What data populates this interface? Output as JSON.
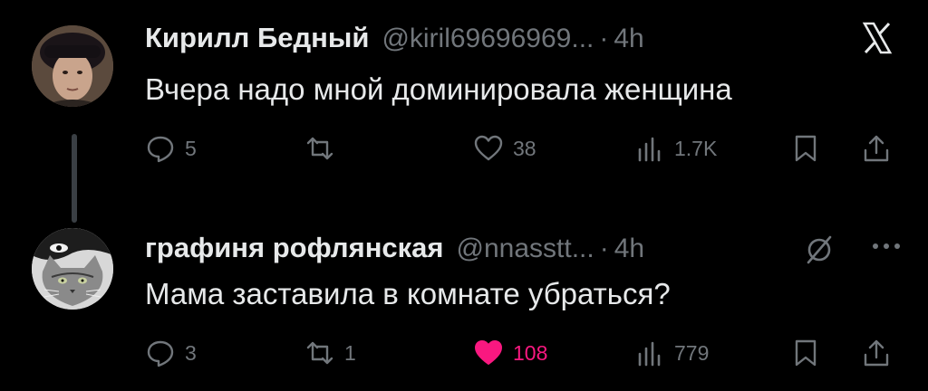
{
  "tweets": [
    {
      "name": "Кирилл Бедный",
      "handle": "@kiril69696969...",
      "separator": "·",
      "time": "4h",
      "text": "Вчера надо мной доминировала женщина",
      "actions": {
        "replies": "5",
        "retweets": "",
        "likes": "38",
        "views": "1.7K"
      },
      "liked": false
    },
    {
      "name": "графиня рофлянская",
      "handle": "@nnasstt...",
      "separator": "·",
      "time": "4h",
      "text": "Мама заставила в комнате убраться?",
      "actions": {
        "replies": "3",
        "retweets": "1",
        "likes": "108",
        "views": "779"
      },
      "liked": true
    }
  ],
  "colors": {
    "background": "#000000",
    "text": "#e7e9ea",
    "muted": "#71767b",
    "like": "#f91880",
    "thread_line": "#3a3f44"
  },
  "icons": {
    "top_right_first": "x-logo-icon",
    "top_right_second": [
      "grok-slash-icon",
      "more-dots-icon"
    ],
    "actions": [
      "reply-icon",
      "retweet-icon",
      "heart-icon",
      "views-icon",
      "bookmark-icon",
      "share-icon"
    ]
  }
}
